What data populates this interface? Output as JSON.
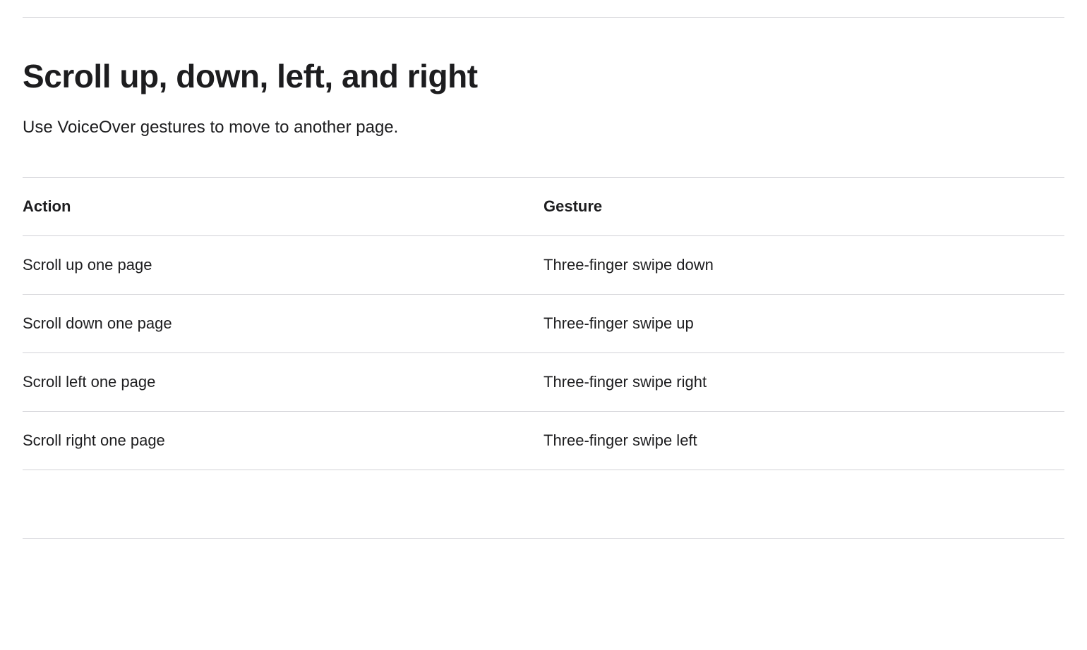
{
  "heading": "Scroll up, down, left, and right",
  "subtitle": "Use VoiceOver gestures to move to another page.",
  "table": {
    "headers": {
      "action": "Action",
      "gesture": "Gesture"
    },
    "rows": [
      {
        "action": "Scroll up one page",
        "gesture": "Three-finger swipe down"
      },
      {
        "action": "Scroll down one page",
        "gesture": "Three-finger swipe up"
      },
      {
        "action": "Scroll left one page",
        "gesture": "Three-finger swipe right"
      },
      {
        "action": "Scroll right one page",
        "gesture": "Three-finger swipe left"
      }
    ]
  }
}
